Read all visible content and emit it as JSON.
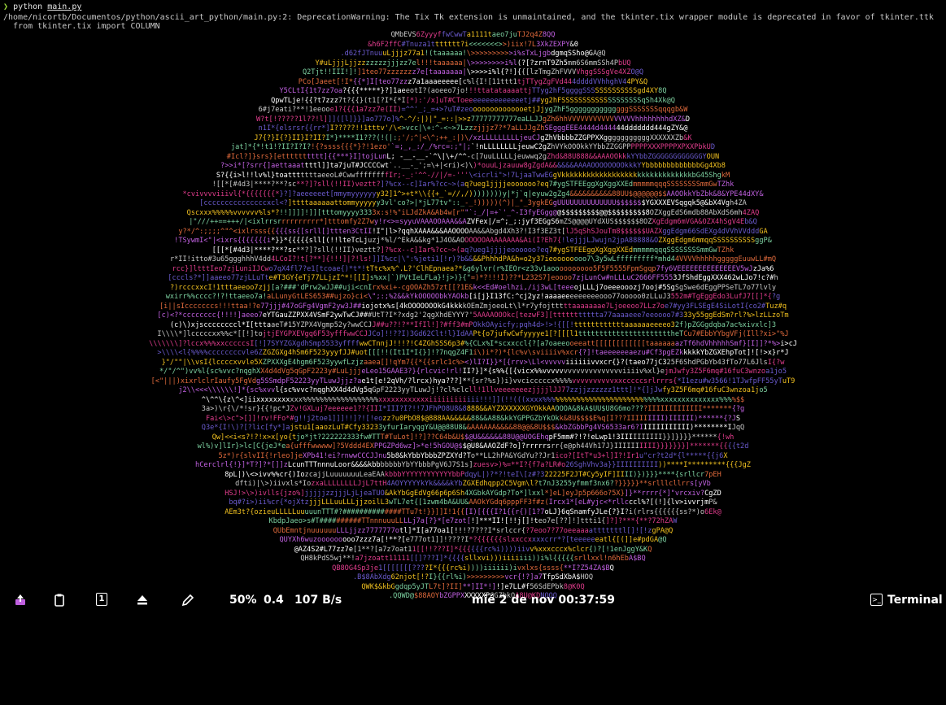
{
  "terminal": {
    "prompt_symbol": "❯",
    "command": "python ",
    "command_file": "main.py",
    "warning_line1": "/home/nicortb/Documentos/python/ascii_art_python/main.py:2: DeprecationWarning: The Tix Tk extension is unmaintained, and the tkinter.tix wrapper module is deprecated in favor of tkinter.ttk",
    "warning_line2": "  from tkinter.tix import COLUMN"
  },
  "ascii_art": [
    "QMbEVS6ZyyyffwCwwTa1111taeo7juTJ2q4Z8QQ",
    "&h6F2ffC#Tnuza1ttttttt?i<<<<<<<>>)iix!7L3XkZEXPY&0",
    ".d62fJTnuuuLjjjz77a1!(taaaaaa!\\>>>>>>>>>>i%sTxLjgbdgmqSSho@GA@Q",
    "Y#uLjjjLjjzzzzzzzjjjzz7el!!!taaaaaa|\\>>>>>>>>i%l(?[?zrnT9Zh5mm6S6mmSSh4PbUQ",
    "Q2Tjt!!III!]!]1teo77zzzzzzz7e[taaaaaaa|\\>>>>i%l{?!]{{[lzTmgZhFVVVVhggSSSgVe4XZO@Q",
    "PCo[Jaeet[!I*{{*]I[teo77zzz7a1aaaeeeee[c%l{I![11ttt1tjTTygZgFVd444ddddVVhhghV44PY&Q",
    "Y5CLtI{1t7zz7oa?{{{*****}?]1aeeotI?(aoeeo7jo!!!ttatataaaattjTTyg2hF5ggggSSSSSSSSSSSSSgd4XY8Q",
    "QpwTLje!{{?t7zzz7t?{{}(t1[?I*{*I[*):'/x]uT#CToeeeeeeeeeeeeeetj##yg2hFSSSSSSSSSSSSSSSSSSSqSh4Xk@Q",
    "6#j7eati?**!1eeooe1?{{{1a7zz7e(II)=^^'_;_=+>?uT#zeoooooooooooooetjJjygZhF5ggggggggggggggSSSSSSSqqqgb&W",
    "W?t[!?????1l??!l]]]([l]}}]ao777o]%^-^/:|)|\"_=::|>>z77777777777eaLLJJgZh6hhVVVVVVVVVVVVVVVVhhhhhhhhdXZ&D",
    "n1I*{elsrsr{{rr*]I?????!!1tttv'/\\<>vcc|\\+:^-<~>7Lzzzjjjz7?*7aLLJJgZhSEgggEEE4444d444444ddddddd444gZY&@",
    "J7{?}I{?}II}I?II?I*}****I1???(!(|:;'/;^|<\\^;++_:|)\\/xzLLLLLLLLLjeuCJgZhVbbbbZZGPPXXgggggggggggXXXXXXZb&K",
    "jat]*{*!t1!?II?I?I?!{?ssss{{{*}?!1ezo'`=;_,_:/_/%rc=:;\"|;`!nLLLLLLLLjeuwC2gZhVYkOOOkkYYbbZZGGPPPPPPXXXPPPPXPXXPbkUD",
    "#Icl?]}srs}[etttttttttt]{{***}I]tojLunL; -__-__-`^\\|\\+/^^-c[7uuLLLLLjeuwwq2gZhd&88U888&&AAAOOkkkYYbbZGGGGGGGGGGGGYOUN",
    "?>>i*[?srr{]aettaaattttl]]ta7juT#JCCCCwt`..__-_';=\\+|<ri)<)\\)*ouuLjzauuw8gZgdA&&&&&&AAAAOOOOOOOOkkkYYbbbbbbbbbbbbbGg4Xb8",
    "S?{{i>l!!lv%l}toatttttttaeeoL#CwwffffffffIr;-_:'^^-//|/=-'''\\<icrli\">!7LjaaTwwEGgVkkkkkkkkkkkkkkkkkkkkkkkkkkkkkkkbG45ShgkM",
    "![[*[#4d3|****?**?sc**?]?sll(!!II)veztt?]?%cx--c]Iar%?cc~>(aq?ueg1jjjjeoooooo?eq7#ygSTFEEggXgXggXXEdmmmmmqqqSSSSSSSSmmGwTZhk",
    "*cvivvvviiivl{*{{{{{{{*}?]?aeeeeeet[mmymyyyyyyy32]1^>+t*\\\\{{+_`=//,/))))))))y|*j`q|eyuw2gZg4&&&&&&&&&&88UU$@@@@@@$$AAOOkkYbZbk&8&YPE44dXY&",
    "[cccccccccccccccxcl<?]ttttaaaaaattommyyyyyy3vl'co?>|*jL77tv\"::_-_!)))))(^)|_\"_3ygkEGgUUUUUUUUUUUUUU$$$$$$$YGXXXEVSqgqk5@&bX4Vgh4ZA",
    "Qscxxx%%%%%vvvvvv%ls*?!!]]]]!]][tttomyyyy3333x:s!%\"iLJdZkA&Ab4w[r\"\"`:_/|=+`'_^-I3fyEGgg@@$$$$$$$$$@@$$$$$$$$$8OZXggEdS6mdb88AbXdS6mh4ZAQ",
    "|\"///++==+++/|<ixlrrsrrrrrrrrrr*]tttomfy2Z7wy!r<>=syyuVAAAOOAAA&&AZVFex|/=^;_;:jyf3EGgS6mZS@@@@UYdXUS$$$$$$8OZXgEdgm6mVGA&OZX4hSgV4Eb&Q",
    "y?*/^:;;;;^\"^<ixlrsss{{{{{ss{[srll[]ttten3CtII!I\"|l>?qqhXAAA&&&AAOOOOAA&&Abgd4Xh3?!I3f3EZ3t[lJ5qShSJouTm8$$$$$$UAZXggEdgm66SdEXg4dVVhVVdddGA",
    "!TSywmI<\"|<ixrs{{{{{{{i*}}*{{{{{sll[(!!lteTcLjuzj*%l/^EkA&&kg*1J4O&AOOOOOOAAAAAAAA&Ai(I?Eh7{!lejjjLJwujn2jpA88888&OZXggEdgm6mmqqSSSSSSSSSSggP&",
    "[[[*[#4d3|****?**?sc**?]?sll(!!II)veztt?]?%cx--c]Iar%?cc~>(aq?ueg1jjjjeoooooo?eq7#ygSTFEEggXgXggXXEdmmmmmqqqSSSSSSSSmmGwTZhk",
    "r*II!itto#3u65ggghhhV4dd4LCoI?!t[?**]{!!!]|?!ls!]]I%cc|\\\":%jeti1[!r)?b&&&&PhhhdPA&h=o2y37ieoooooooo7\\3y5wLfffffffff*mhd44VVVVhhhhhgggggEuuwLL#mQ",
    "rcc}]ltttIeo7zjLuniIJCwo7qX4fl7?e1[tcoae{)*t*!tTtc%x%^.L?'ClhEpnaea?*&g6ylvr(r%IEOr<z33v1aoooooooooo5F5F5555FpmSgqp7fy6VEEEEEEEEEEEEEEV5wJzJa%6",
    "[cccls?*]]aaeeo77zjLLuTte#T3GY{eTj77LLjzI^*![[I]s%xx|`)PVtIeLFLa}!j>)}{\"=)*?!!!I)??*L232S7]eoooo7zjLunCw#nLLLuC2666FF5553JfShdEggXXX462wLJo7!c?#h",
    "?)rcccxxcI!1tttaeeoo7zjj[a?###'dPrw2wJJ##uji<cnIrx%xi+-cgOOAZh57zt[[?1E&k<<Ed#oelhzi,/ij3wL[teeeojLLLj7oeeeooozj7ooj#5SgSgSwe6dEggPPSeTL7o77lvly",
    "wxirr%%cccc?!?!ttaeeo7a!aLLunyGtLES653##ujzo}ci<\\\";:;%2&&kYkOOOOObkYAOkb[i[j}I13fC:^cj2yz!aaaaeeeeeeeeeooo77ooooo0zLLuJ3552m#TgEggEdo3LufJ7[[]*{?g",
    "[i||sIcccccccs!!!ttaa!?e77jjj#47oGFg4VgmF2yw3J##iojotx%s[4kOOOOOOOkG4kkkkOEmZmjoeoLt\\l*r7yfojtttttaaaaaaae7Ljoeeoo7LLz7oe7#yy3FLSEgE4SiLotI{co2#Tuz#q",
    "[c)<?*cccccccc{!!!!]aeeo7eYTGauZZPXX4VSmF2ywTwCJ###UtT?I*?xdg2'2qgXhdEYYY?'5AAAAOOOkc[tezwF3][ttttttttttta77aaaaeee7eeoooo7#333y55ggEdSm?rl?%>lzLLzoTm",
    "(c)\\)xjsccccccccl*I[tttaaeT#15YZPX4Vgmp52y?wwCCJJ##u??!?**IfIl!]?#ff3#mPOkkOAyicfy;pqh4d>!>!{[[!ttttttttttttaaaaaaeeeeo32f)pZGGgdqba7ac%xivxlc]3",
    "I\\\\\\\\*]lcccccxx%%c*[[!]tojtjEYGPXEVgq6F53yfffwwCCJJCo]!!??I)3Gd62Clt!l}IdAAPt{o7jufwCwfyyyye1[?[[[l1ttttttttttttttttttttttheTCu7#EbbYYbgVFj(Ill?xi>\"%J",
    "\\\\\\\\\\\\\\]?lccx%%%xxcccccsI[!]7SYYZGXgdhSmp5533yffffwwCTnnjJ!!!?!C4ZGhSSS6p3#%{CLx%I*scxxccl{?[a7oaeeooeeatt[[[[[[[[[[[[taaaaaaazTf6hdVhhhhhSmf}[I]]?*%>i>cJ",
    ">\\\\\\\\<l{%%%%ccccccccvle6ZZGZGXg4hSm6F523yyyfJJ#uot[[[!!(It1I*I{}]!?7nqgZ4F1i\\)i*?)*{lc%v\\sviiiiv%xcr{?]!taeeeeeeaezu#Cf3pgEZkkkkkYbZGXEhpTot]![!>x}r*J",
    "}\"/\"\"|\\\\vsI{lccccxvvle5XZPXXXgE4hgm6F523yywfLzjzaaea[]!qYm7{{*{{srlc1c%><)lI?I}}*[{rrv>\\Ll<vvvvviiiiiivvxcr{}?(taeo77jC325F6ShdPGbYb43fTo77L6JlsI{?w",
    "*/\"/^\")vv%l{sc%vvc?nqghXX4d4dVg5qGpF2223y#LuLjjjeLeo15GAAE3?}{rlcvic!rl!II?}]*{s%%{[{vicx%%vvvvvvvvvvvvvvvvvvviiiiv%xl}ejmJwfy3Z5F6mq#16fuC3wnzoa1jo5",
    "[<\"|||)xixrlclrIaufy5FgVdg5SSmdpF52223yyTLuwJjjz?ae1t[e!2qVh/?lrcx)hya???]**{sr?%s})i}vvcicccccx%%%%vvvvvvvvvvxxcccccsrlrrrs{*I1ezu#w3566!1TJwfpFF55yTuT9",
    "j2\\\\<<<\\\\\\\\\\\\!]*{sc%xvvl{sc%vvc?nqghXX4d4dVg5qGpF2223yyTLuwJj!?cl%clcll!1llveeeeeeezjjjjlJJ77zzjjzzzzzz1ttt]!*{]jJwfy3Z5F6mq#16fuC3wnzoa1jo5",
    "^\\^^\\{z\\^<]iixxxxxxxxxxx%%%%%%%%%%%%%%%%%%xxxxxxxxxxxxiiiiiiiiiiii!!!]](!!(((xxxx%%%%%%%%%%%%%%%%%%%%%%%%%%%%xxxxxxxxxxxxxx%%%%$$",
    "3a>)\\r{\\/*!sr}{{!pc*JZv!GXLuj7eeeeee1??{III*III?I?!!7JFhPO8U8&8888&&AYZXXXXXXGYOkkAAOOOA&8kA$UU$U8G6mo????IIIIIIIIIIIII*******{?g",
    "Fai<\\>c\">[]]!rv!FFo*#g!!j2toe1]]]!!]?![!eozz?u0PbO8$@888AA&&&&&88&&A88&kkYGPPGZbYkOkk&8U$$$$E%q[I???IIIIIIIII)IIIIII)******{?JS",
    "Q3e*{I!\\)?[?lic[fy*]ajstu1[aaozLuT#Cfy33233yfurIaryqgY&U@@88U8&&AAAAAA&&&&88@@&8U$$$&kbZGbbPg4VS6533ar6?IIIIIIIIIIII)********IJqQ",
    "Qw]<<i<s?!?!x>x[yo{tjo*jt?222222333fw#TTT#TuLot]!?]??C64b&U$$@U&&&&&&88U@@UOGEhqpF5mm#?!?!eLwp1!3IIIIIIIIII}}]}}}}******{!wh",
    "wl%)v]lIr}>lc[C{jeJ*ea{ufffwwwww]?5Vddd4EXPPGZPd6wz]>*e!5hGOU@$$@U8&AAOZdF?o]?rrrrrsrr{e@ph44Vh17J}IIIIIIIIII}}}}}}}]*******{{{{t2d",
    "5z*)r{slvII{!rleo]jeXPb41!ei?rnwwCCCJJnu5b8&kYbbYbbbZPZXYd?To**LL2hPA&YGdYu??Jr1ico?[ItT*u3+l]I?!Ir1u\"cr?t2d*{l*****{{j6X",
    "hCerclrl{!}]*T?]?*[]]zLcunTTTnnnuLoor&&&&kbbbbbbbYbYYbbbPgV6J7S1s]zuesv>)%=**I?{f7a?LR#o26SghVhv3a}}IIIIIIIIII))****I*********{{{JgZ",
    "8pL|)\\<>ivv%%cr{)IozcajjLuuuuuuuLeaEAAkbbbYYYYYYYYYYYYbbPdqyL|)?*?!teI\\[z#?322225F2JT#Cy5yIF]IIII)})}}}****{srllcr7pEH",
    "dfti)|\\>)iivxls*IozxaLLLLLLLLJjL7ttH4AOYYYYYkYk&&&&kYbZGXEdhqpp2C5Vgm\\l?t7nJ3255yfmmf3nx6??}}}}}**srlllcllrrs[yVb",
    "HSJ!>\\>)ivlls{jzo%]jjjjjzzjjjLjLjeaTUO&AkYbGgEdVg66p6p6Sh4XGbkAYGdp?To*]lxxl*]eL]eyJp5p666o?5X}]}**rrrr{*]\"vrcxiv?CgZD",
    "bq#?i>)ii%cr{*ojXtzjjjLLLuuLLLjjzoilL3wTL7et{[1zwm4bA&UU&AAOkYGdq6pppFF3f#z(Ircx1*[eL#yjc<*rllcccl%?[(!]{lv>ivvrjmP&",
    "AEm3t?{ozieuLLLLLuuuuunTTT#?##############TTu7t!}}]]I!1{{[I)[{{{I?1{{r{)[1?7oLJ}6qSnamfyJLe{?}I?i(rlrs{{{{{{ss?*)o6Ek@",
    "KbdpJaeo>s#T##########TTnnnuuuLLLLj7a[?}*[e7zot[!]***II![!!j[]!teo7e[??]!]ttti1{]?]?***{**?72hZAW",
    "QUbEmntjnuuuuuuLLLjjzz7777777otl]*I[a77oa1[!!!?7???I*srlccr{?7eoo7?77oeeaaaatttttttl[]![!zgPA@Q",
    "QUYXh6wuzooooooooo7zzz7a[!**?[e777ot1]]!????I*?{{{{{{slxxccxxxxcrr*?[teeeeeeatl{[(]]e#pdGA@Q",
    "@AZ4S2#L77zz7e[1**?[a7z7oat11[[!!???I]*{{{{{{rc%i))))iivv%xxxcccx%clcr{)?[!1enJggY&KQ",
    "QH8kPdS5wj**!a7jzoatt11111[[]???I]*{{{{sllxvi)))iiiiiii))i%l{{{{{srllxxl!n6hEbA$BQ",
    "QB8OG4Sp3je1[[[[[[[????I*{{{rc%i))))iiiiii)ivxlxs{ssss{**I?Z54ZA$BQ",
    ".B$8AbXdg62njot[!?I}{{rl%i)>>>>>>>>>vcr{!?]a7TfpSdXbA$HOQ",
    "QWK$&kbGgdqp5yJTL7t]?II]**]II*!]!]e7LL#f56SdEPbk8@K0Q",
    ".QQWD@$88AOYbZGPPXXXXXXPGGZbkOA8U@KDNQQQ"
  ],
  "art_colors": [
    "#c8c8c8",
    "#e03c8c",
    "#6a5acd",
    "#f0c020",
    "#7cd0a0",
    "#e06a3c",
    "#c060e0",
    "#ffffff"
  ],
  "bar": {
    "battery_percent": "50%",
    "load": "0.4",
    "net_speed": "107 B/s",
    "date": "mié  2 de nov  00:37:59",
    "workspace": "1",
    "terminal_label": "Terminal",
    "icons": [
      "upload-icon",
      "clipboard-icon",
      "workspace-icon",
      "eject-icon",
      "pencil-icon",
      "terminal-icon"
    ]
  }
}
